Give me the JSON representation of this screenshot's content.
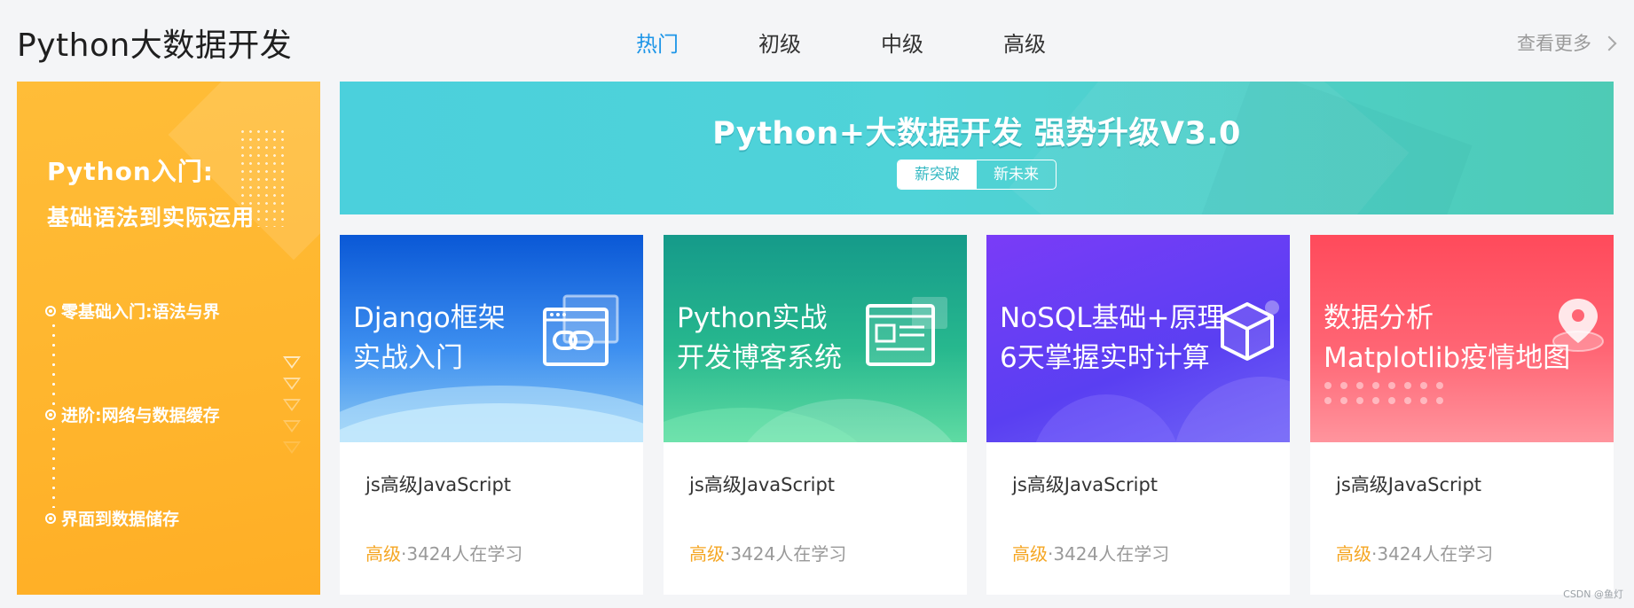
{
  "header": {
    "title": "Python大数据开发",
    "tabs": [
      {
        "label": "热门",
        "active": true
      },
      {
        "label": "初级",
        "active": false
      },
      {
        "label": "中级",
        "active": false
      },
      {
        "label": "高级",
        "active": false
      }
    ],
    "more_label": "查看更多"
  },
  "promo": {
    "title": "Python入门:",
    "subtitle": "基础语法到实际运用",
    "steps": [
      "零基础入门:语法与界",
      "进阶:网络与数据缓存",
      "界面到数据储存"
    ]
  },
  "banner": {
    "title": "Python+大数据开发 强势升级V3.0",
    "pill_left": "薪突破",
    "pill_right": "新未来"
  },
  "cards": [
    {
      "thumb_line1": "Django框架",
      "thumb_line2": "实战入门",
      "title": "js高级JavaScript",
      "level": "高级",
      "learners": "·3424人在学习",
      "colors": [
        "#0a58d6",
        "#3d8ff0",
        "#a8d8f7"
      ],
      "icon": "link-window-icon"
    },
    {
      "thumb_line1": "Python实战",
      "thumb_line2": "开发博客系统",
      "title": "js高级JavaScript",
      "level": "高级",
      "learners": "·3424人在学习",
      "colors": [
        "#159a8a",
        "#2cbe8f",
        "#6be0a8"
      ],
      "icon": "document-window-icon"
    },
    {
      "thumb_line1": "NoSQL基础+原理",
      "thumb_line2": "6天掌握实时计算",
      "title": "js高级JavaScript",
      "level": "高级",
      "learners": "·3424人在学习",
      "colors": [
        "#6f35f5",
        "#5a3ff2",
        "#7a6cf7"
      ],
      "icon": "cube-icon"
    },
    {
      "thumb_line1": "数据分析",
      "thumb_line2": "Matplotlib疫情地图",
      "title": "js高级JavaScript",
      "level": "高级",
      "learners": "·3424人在学习",
      "colors": [
        "#ff4a5b",
        "#ff6a78",
        "#ff9ba3"
      ],
      "icon": "map-pin-icon"
    }
  ],
  "watermark": "CSDN @鱼灯"
}
